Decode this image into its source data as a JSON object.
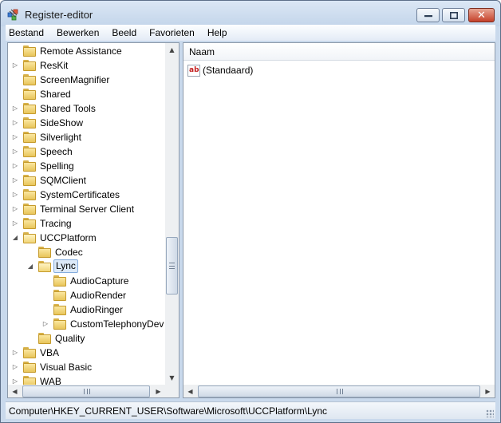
{
  "window": {
    "title": "Register-editor",
    "minimize_symbol": "—",
    "maximize_symbol": "□",
    "close_symbol": "✕"
  },
  "menu": {
    "items": [
      {
        "label": "Bestand"
      },
      {
        "label": "Bewerken"
      },
      {
        "label": "Beeld"
      },
      {
        "label": "Favorieten"
      },
      {
        "label": "Help"
      }
    ]
  },
  "tree": {
    "expanded_symbol": "◢",
    "collapsed_symbol": "▷",
    "items": [
      {
        "label": "Remote Assistance",
        "expander": "none"
      },
      {
        "label": "ResKit",
        "expander": "collapsed"
      },
      {
        "label": "ScreenMagnifier",
        "expander": "none"
      },
      {
        "label": "Shared",
        "expander": "none"
      },
      {
        "label": "Shared Tools",
        "expander": "collapsed"
      },
      {
        "label": "SideShow",
        "expander": "collapsed"
      },
      {
        "label": "Silverlight",
        "expander": "collapsed"
      },
      {
        "label": "Speech",
        "expander": "collapsed"
      },
      {
        "label": "Spelling",
        "expander": "collapsed"
      },
      {
        "label": "SQMClient",
        "expander": "collapsed"
      },
      {
        "label": "SystemCertificates",
        "expander": "collapsed"
      },
      {
        "label": "Terminal Server Client",
        "expander": "collapsed"
      },
      {
        "label": "Tracing",
        "expander": "collapsed"
      },
      {
        "label": "UCCPlatform",
        "expander": "expanded"
      },
      {
        "label": "Codec",
        "expander": "none"
      },
      {
        "label": "Lync",
        "expander": "expanded",
        "selected": true
      },
      {
        "label": "AudioCapture",
        "expander": "none"
      },
      {
        "label": "AudioRender",
        "expander": "none"
      },
      {
        "label": "AudioRinger",
        "expander": "none"
      },
      {
        "label": "CustomTelephonyDev",
        "expander": "collapsed"
      },
      {
        "label": "Quality",
        "expander": "none"
      },
      {
        "label": "VBA",
        "expander": "collapsed"
      },
      {
        "label": "Visual Basic",
        "expander": "collapsed"
      },
      {
        "label": "WAB",
        "expander": "collapsed"
      }
    ]
  },
  "scrollbars": {
    "up_arrow": "▲",
    "down_arrow": "▼",
    "left_arrow": "◀",
    "right_arrow": "▶"
  },
  "list": {
    "column_name": "Naam",
    "values": [
      {
        "name": "(Standaard)",
        "icon": "ab-string-icon",
        "icon_text": "ab"
      }
    ]
  },
  "statusbar": {
    "path": "Computer\\HKEY_CURRENT_USER\\Software\\Microsoft\\UCCPlatform\\Lync"
  },
  "colors": {
    "selection_fill": "#dce9f8",
    "selection_border": "#84acdd",
    "folder_yellow": "#e8c55a",
    "close_red": "#c5412a"
  }
}
